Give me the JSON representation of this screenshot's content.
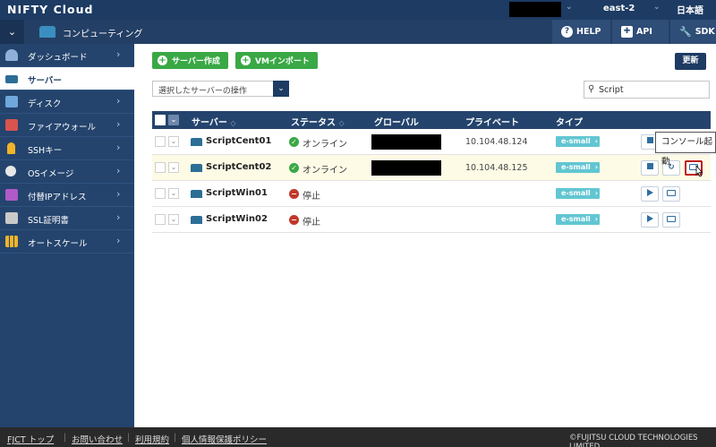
{
  "header": {
    "logo": "NIFTY Cloud",
    "region": "east-2",
    "language": "日本語"
  },
  "subheader": {
    "service_title": "コンピューティング",
    "help": "HELP",
    "api": "API",
    "sdk": "SDK"
  },
  "sidebar": {
    "items": [
      {
        "label": "ダッシュボード",
        "icon": "dashboard-icon"
      },
      {
        "label": "サーバー",
        "icon": "server-icon"
      },
      {
        "label": "ディスク",
        "icon": "disk-icon"
      },
      {
        "label": "ファイアウォール",
        "icon": "firewall-icon"
      },
      {
        "label": "SSHキー",
        "icon": "key-icon"
      },
      {
        "label": "OSイメージ",
        "icon": "os-image-icon"
      },
      {
        "label": "付替IPアドレス",
        "icon": "ip-address-icon"
      },
      {
        "label": "SSL証明書",
        "icon": "ssl-certificate-icon"
      },
      {
        "label": "オートスケール",
        "icon": "autoscale-icon"
      }
    ]
  },
  "toolbar": {
    "create_server": "サーバー作成",
    "vm_import": "VMインポート",
    "refresh": "更新",
    "action_select": "選択したサーバーの操作",
    "search_value": "Script"
  },
  "table": {
    "headers": {
      "server": "サーバー",
      "status": "ステータス",
      "global": "グローバル",
      "private": "プライベート",
      "type": "タイプ"
    },
    "rows": [
      {
        "name": "ScriptCent01",
        "status": "オンライン",
        "private": "10.104.48.124",
        "type": "e-small"
      },
      {
        "name": "ScriptCent02",
        "status": "オンライン",
        "private": "10.104.48.125",
        "type": "e-small"
      },
      {
        "name": "ScriptWin01",
        "status": "停止",
        "private": "",
        "type": "e-small"
      },
      {
        "name": "ScriptWin02",
        "status": "停止",
        "private": "",
        "type": "e-small"
      }
    ]
  },
  "tooltip": "コンソール起動",
  "footer": {
    "links": [
      "FJCT トップ",
      "お問い合わせ",
      "利用規約",
      "個人情報保護ポリシー"
    ],
    "copyright": "©FUJITSU CLOUD TECHNOLOGIES LIMITED"
  },
  "colors": {
    "header_bg": "#1d3b63",
    "sidebar_bg": "#24446d",
    "accent_green": "#3aa845",
    "type_badge": "#62c6d2",
    "highlight_row": "#fdfbe6",
    "stop_red": "#c0392b"
  }
}
